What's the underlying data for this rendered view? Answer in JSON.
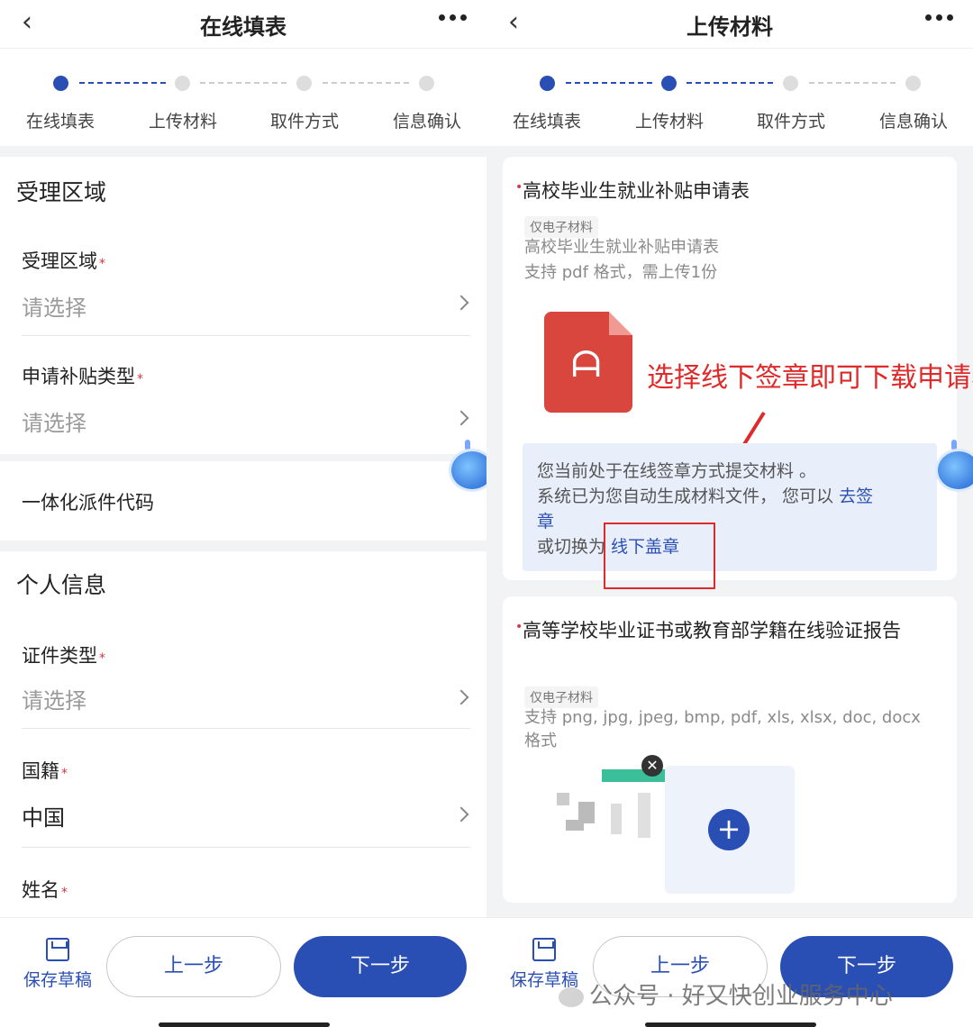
{
  "left": {
    "header_title": "在线填表",
    "steps": [
      "在线填表",
      "上传材料",
      "取件方式",
      "信息确认"
    ],
    "sections": {
      "region_title": "受理区域",
      "personal_title": "个人信息"
    },
    "fields": {
      "region_label": "受理区域",
      "region_value": "请选择",
      "subsidy_label": "申请补贴类型",
      "subsidy_value": "请选择",
      "code_label": "一体化派件代码",
      "id_type_label": "证件类型",
      "id_type_value": "请选择",
      "nationality_label": "国籍",
      "nationality_value": "中国",
      "name_label": "姓名"
    },
    "required_mark": "*",
    "bottom": {
      "save_label": "保存草稿",
      "prev_label": "上一步",
      "next_label": "下一步"
    }
  },
  "right": {
    "header_title": "上传材料",
    "steps": [
      "在线填表",
      "上传材料",
      "取件方式",
      "信息确认"
    ],
    "card1": {
      "title": "高校毕业生就业补贴申请表",
      "tag": "仅电子材料",
      "desc1": "高校毕业生就业补贴申请表",
      "desc2": "支持 pdf 格式，需上传1份",
      "annotation": "选择线下签章即可下载申请表",
      "notice_line1": "您当前处于在线签章方式提交材料 。",
      "notice_line2_a": "系统已为您自动生成材料文件，  您可以 ",
      "notice_line2_link": "去签",
      "notice_line3_link": "章",
      "notice_line4_a": "或切换为 ",
      "notice_line4_link": "线下盖章"
    },
    "card2": {
      "title": "高等学校毕业证书或教育部学籍在线验证报告",
      "tag": "仅电子材料",
      "desc": "支持 png, jpg, jpeg, bmp, pdf, xls, xlsx, doc, docx 格式"
    },
    "bottom": {
      "save_label": "保存草稿",
      "prev_label": "上一步",
      "next_label": "下一步"
    },
    "watermark": "公众号 · 好又快创业服务中心"
  },
  "colors": {
    "primary": "#2a4fb4",
    "required": "#d9363e",
    "annotation": "#e02a2a"
  }
}
